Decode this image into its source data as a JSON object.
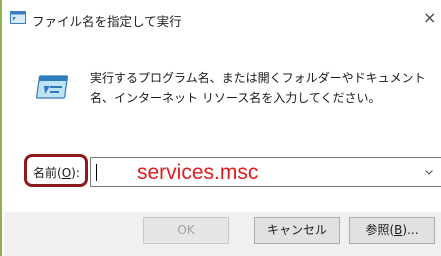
{
  "window": {
    "title": "ファイル名を指定して実行",
    "close_glyph": "×"
  },
  "description": "実行するプログラム名、または開くフォルダーやドキュメント名、インターネット リソース名を入力してください。",
  "name_field": {
    "label_prefix": "名前(",
    "label_accel": "O",
    "label_suffix": "):",
    "value": "services.msc"
  },
  "buttons": {
    "ok": "OK",
    "cancel": "キャンセル",
    "browse_prefix": "参照(",
    "browse_accel": "B",
    "browse_suffix": ")..."
  },
  "colors": {
    "value_text": "#e11b1b",
    "highlight_border": "#8b1a1a",
    "window_accent": "#8fb34a"
  },
  "icons": {
    "title": "run-dialog-icon",
    "body": "run-program-icon",
    "dropdown": "chevron-down-icon",
    "close": "close-icon"
  }
}
